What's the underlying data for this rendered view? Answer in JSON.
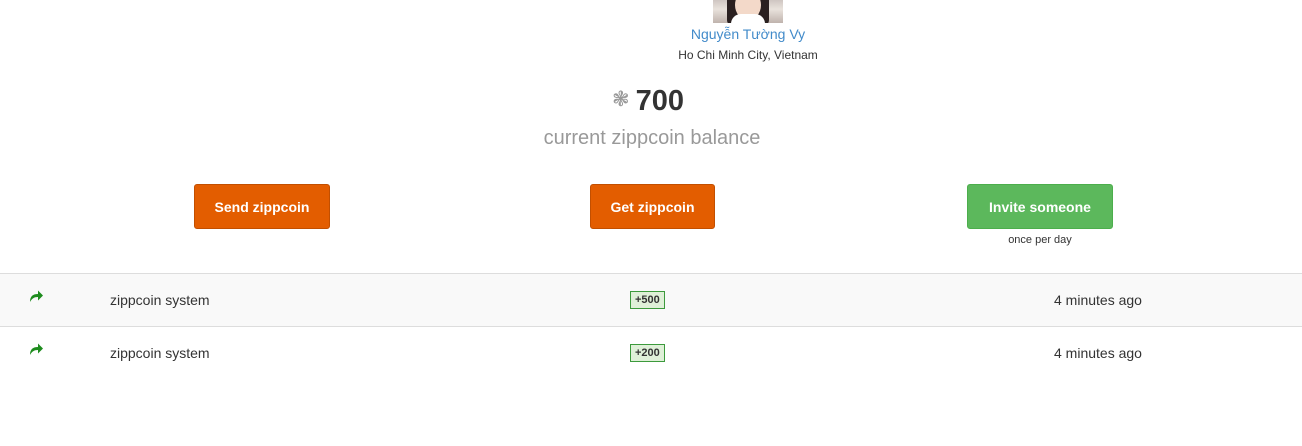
{
  "profile": {
    "name": "Nguyễn Tường Vy",
    "location": "Ho Chi Minh City, Vietnam",
    "avatar_icon": "user-photo"
  },
  "balance": {
    "icon": "zippcoin-icon",
    "amount": "700",
    "caption": "current zippcoin balance"
  },
  "actions": {
    "send_label": "Send zippcoin",
    "get_label": "Get zippcoin",
    "invite_label": "Invite someone",
    "invite_note": "once per day"
  },
  "colors": {
    "accent_orange": "#e35d00",
    "accent_green": "#5cb85c",
    "link_blue": "#428bca",
    "badge_bg": "#dff0d8"
  },
  "transactions": [
    {
      "icon": "share-arrow-icon",
      "source": "zippcoin system",
      "amount": "+500",
      "time": "4 minutes ago"
    },
    {
      "icon": "share-arrow-icon",
      "source": "zippcoin system",
      "amount": "+200",
      "time": "4 minutes ago"
    }
  ]
}
